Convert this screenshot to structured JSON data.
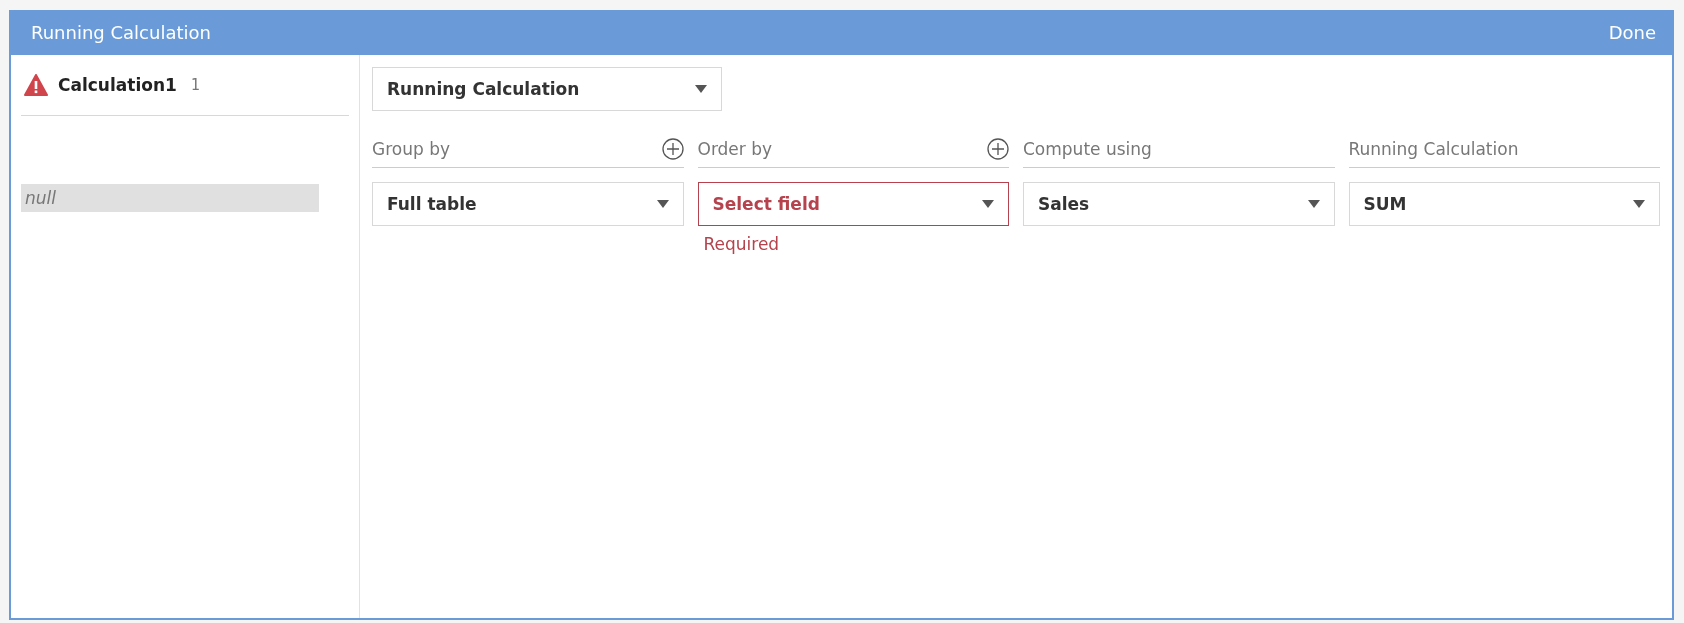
{
  "window": {
    "title": "Running Calculation",
    "done_label": "Done"
  },
  "sidebar": {
    "calculation": {
      "name": "Calculation1",
      "count": "1",
      "has_error": true
    },
    "value": "null"
  },
  "calc_type": {
    "value": "Running Calculation"
  },
  "columns": [
    {
      "label": "Group by",
      "has_add": true,
      "value": "Full table",
      "error": false
    },
    {
      "label": "Order by",
      "has_add": true,
      "value": "Select field",
      "error": true,
      "error_text": "Required"
    },
    {
      "label": "Compute using",
      "has_add": false,
      "value": "Sales",
      "error": false
    },
    {
      "label": "Running Calculation",
      "has_add": false,
      "value": "SUM",
      "error": false
    }
  ]
}
